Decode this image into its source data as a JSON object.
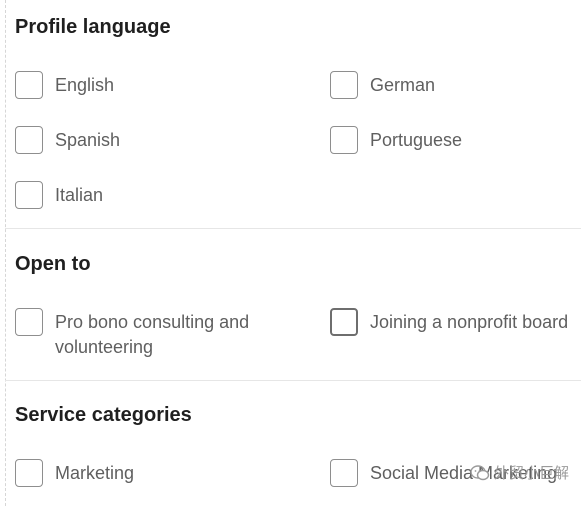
{
  "profile_language": {
    "title": "Profile language",
    "options": [
      "English",
      "German",
      "Spanish",
      "Portuguese",
      "Italian"
    ]
  },
  "open_to": {
    "title": "Open to",
    "options": [
      "Pro bono consulting and volunteering",
      "Joining a nonprofit board"
    ]
  },
  "service_categories": {
    "title": "Service categories",
    "options": [
      "Marketing",
      "Social Media Marketing"
    ]
  },
  "watermark": {
    "text": "外贸小巨解"
  },
  "colors": {
    "title_text": "#1f1f1f",
    "label_text": "#5f5f5f",
    "checkbox_border": "#8e8e8e",
    "divider": "#e6e6e6"
  }
}
